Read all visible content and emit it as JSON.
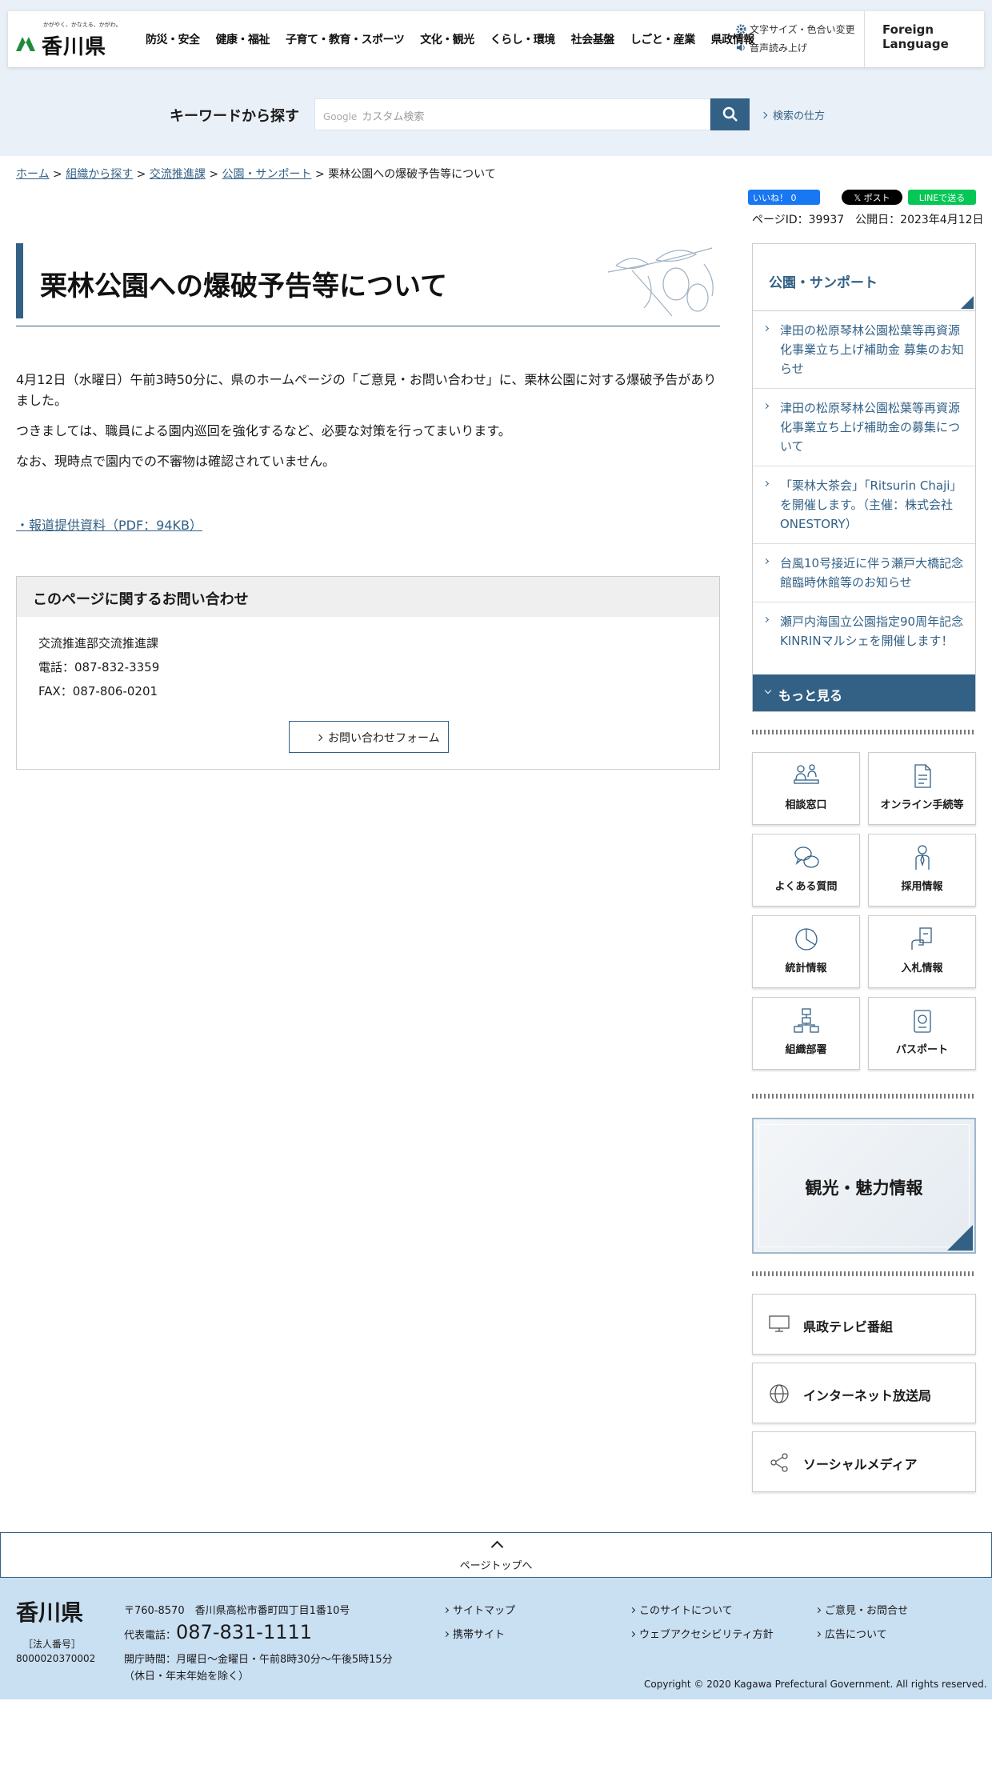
{
  "header": {
    "logo_tagline": "かがやく、かなえる、かがわ。",
    "logo_name": "香川県",
    "nav": [
      "防災・安全",
      "健康・福祉",
      "子育て・教育・スポーツ",
      "文化・観光",
      "くらし・環境",
      "社会基盤",
      "しごと・産業",
      "県政情報"
    ],
    "font_color_label": "文字サイズ・色合い変更",
    "voice_label": "音声読み上げ",
    "foreign_label": "Foreign Language"
  },
  "search": {
    "label": "キーワードから探す",
    "google": "Google",
    "placeholder": "カスタム検索",
    "help": "検索の仕方"
  },
  "breadcrumb": {
    "items": [
      "ホーム",
      "組織から探す",
      "交流推進課",
      "公園・サンポート"
    ],
    "current": "栗林公園への爆破予告等について",
    "sep": " > "
  },
  "social": {
    "fb": "いいね！ 0",
    "x": "ポスト",
    "line": "LINEで送る"
  },
  "meta": {
    "page_id": "ページID：39937",
    "published": "公開日：2023年4月12日"
  },
  "article": {
    "title": "栗林公園への爆破予告等について",
    "paragraphs": [
      "4月12日（水曜日）午前3時50分に、県のホームページの「ご意見・お問い合わせ」に、栗林公園に対する爆破予告がありました。",
      "つきましては、職員による園内巡回を強化するなど、必要な対策を行ってまいります。",
      "なお、現時点で園内での不審物は確認されていません。"
    ],
    "pdf_link": "・報道提供資料（PDF：94KB）"
  },
  "contact": {
    "heading": "このページに関するお問い合わせ",
    "dept": "交流推進部交流推進課",
    "tel": "電話：087-832-3359",
    "fax": "FAX：087-806-0201",
    "form_label": "お問い合わせフォーム"
  },
  "sidebar": {
    "heading": "公園・サンポート",
    "items": [
      "津田の松原琴林公園松葉等再資源化事業立ち上げ補助金 募集のお知らせ",
      "津田の松原琴林公園松葉等再資源化事業立ち上げ補助金の募集について",
      "「栗林大茶会」「Ritsurin Chaji」 を開催します。（主催：株式会社ONESTORY）",
      "台風10号接近に伴う瀬戸大橋記念館臨時休館等のお知らせ",
      "瀬戸内海国立公園指定90周年記念KINRINマルシェを開催します！"
    ],
    "more": "もっと見る",
    "tiles": [
      "相談窓口",
      "オンライン手続等",
      "よくある質問",
      "採用情報",
      "統計情報",
      "入札情報",
      "組織部署",
      "パスポート"
    ],
    "banner": "観光・魅力情報",
    "links": [
      "県政テレビ番組",
      "インターネット放送局",
      "ソーシャルメディア"
    ]
  },
  "pagetop": "ページトップへ",
  "footer": {
    "name": "香川県",
    "corp_label": "［法人番号］",
    "corp_no": "8000020370002",
    "address": "〒760-8570　香川県高松市番町四丁目1番10号",
    "tel_label": "代表電話：",
    "tel": "087-831-1111",
    "hours1": "開庁時間：月曜日～金曜日・午前8時30分～午後5時15分",
    "hours2": "（休日・年末年始を除く）",
    "links": [
      "サイトマップ",
      "携帯サイト",
      "このサイトについて",
      "ウェブアクセシビリティ方針",
      "ご意見・お問合せ",
      "広告について"
    ],
    "copyright": "Copyright © 2020 Kagawa Prefectural Government. All rights reserved."
  },
  "colors": {
    "primary": "#336186",
    "band": "#eaf0f7",
    "footer": "#c9dff2"
  }
}
